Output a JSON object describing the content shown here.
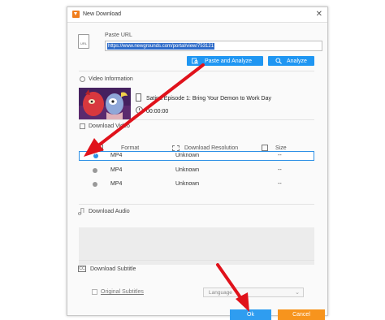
{
  "window": {
    "title": "New Download"
  },
  "url_section": {
    "label": "Paste URL",
    "url_value": "https://www.newgrounds.com/portal/view/753121",
    "paste_analyze_label": "Paste and Analyze",
    "analyze_label": "Analyze"
  },
  "video_info": {
    "section_label": "Video Information",
    "title": "Satina Episode 1: Bring Your Demon to Work Day",
    "duration": "00:00:00"
  },
  "download_video": {
    "section_label": "Download Video",
    "columns": {
      "format": "Format",
      "resolution": "Download Resolution",
      "size": "Size"
    },
    "rows": [
      {
        "format": "MP4",
        "resolution": "Unknown",
        "size": "--",
        "selected": true
      },
      {
        "format": "MP4",
        "resolution": "Unknown",
        "size": "--",
        "selected": false
      },
      {
        "format": "MP4",
        "resolution": "Unknown",
        "size": "--",
        "selected": false
      }
    ]
  },
  "download_audio": {
    "section_label": "Download Audio"
  },
  "download_subtitle": {
    "section_label": "Download Subtitle",
    "original_subtitles": "Original Subtitles",
    "language_placeholder": "Language"
  },
  "footer": {
    "ok_label": "Ok",
    "cancel_label": "Cancel"
  },
  "colors": {
    "accent_blue": "#1f96f2",
    "cancel_orange": "#f7941d",
    "annotation_red": "#e0121b"
  }
}
